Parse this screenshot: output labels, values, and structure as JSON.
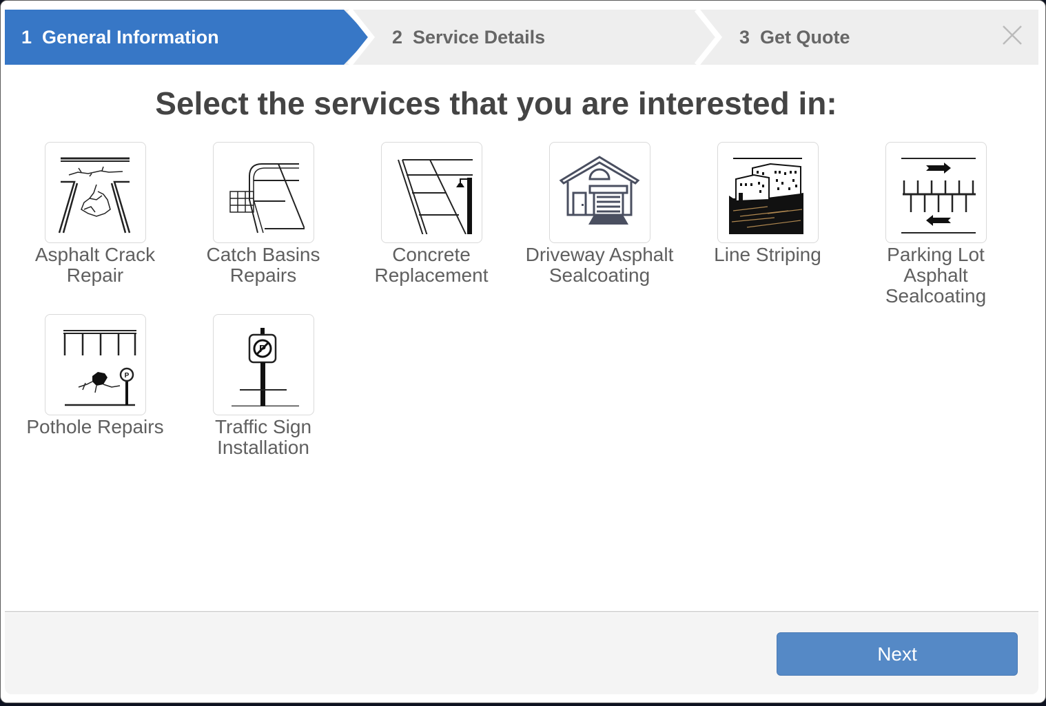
{
  "wizard": {
    "steps": [
      {
        "number": "1",
        "label": "General Information",
        "active": true
      },
      {
        "number": "2",
        "label": "Service Details",
        "active": false
      },
      {
        "number": "3",
        "label": "Get Quote",
        "active": false
      }
    ],
    "close_icon": "close-icon"
  },
  "main": {
    "title": "Select the services that you are interested in:",
    "services": [
      {
        "label": "Asphalt Crack Repair",
        "icon": "asphalt-crack-icon"
      },
      {
        "label": "Catch Basins Repairs",
        "icon": "catch-basin-icon"
      },
      {
        "label": "Concrete Replacement",
        "icon": "concrete-sidewalk-icon"
      },
      {
        "label": "Driveway Asphalt Sealcoating",
        "icon": "house-garage-icon"
      },
      {
        "label": "Line Striping",
        "icon": "buildings-icon"
      },
      {
        "label": "Parking Lot Asphalt Sealcoating",
        "icon": "parking-lot-icon"
      },
      {
        "label": "Pothole Repairs",
        "icon": "pothole-icon"
      },
      {
        "label": "Traffic Sign Installation",
        "icon": "no-parking-sign-icon"
      }
    ]
  },
  "footer": {
    "next_label": "Next"
  },
  "colors": {
    "active_step": "#3777c6",
    "inactive_step": "#eeeeee",
    "next_button": "#5589c6",
    "title_text": "#444444",
    "label_text": "#5f5f5f"
  }
}
